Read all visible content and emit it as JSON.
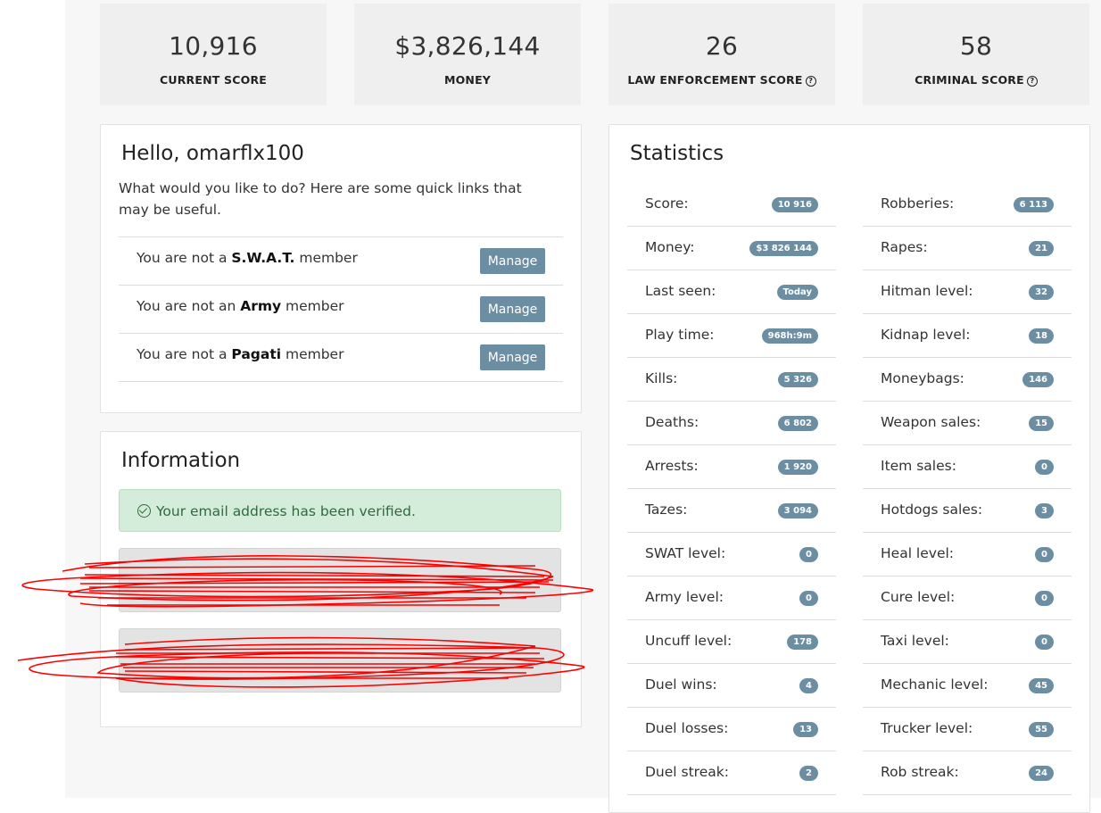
{
  "top_stats": [
    {
      "value": "10,916",
      "label": "CURRENT SCORE",
      "help": false
    },
    {
      "value": "$3,826,144",
      "label": "MONEY",
      "help": false
    },
    {
      "value": "26",
      "label": "LAW ENFORCEMENT SCORE",
      "help": true
    },
    {
      "value": "58",
      "label": "CRIMINAL SCORE",
      "help": true
    }
  ],
  "welcome": {
    "title": "Hello, omarflx100",
    "intro": "What would you like to do? Here are some quick links that may be useful.",
    "links": [
      {
        "prefix": "You are not a ",
        "group": "S.W.A.T.",
        "suffix": " member",
        "button": "Manage"
      },
      {
        "prefix": "You are not an ",
        "group": "Army",
        "suffix": " member",
        "button": "Manage"
      },
      {
        "prefix": "You are not a ",
        "group": "Pagati",
        "suffix": " member",
        "button": "Manage"
      }
    ]
  },
  "information": {
    "title": "Information",
    "verified": "Your email address has been verified."
  },
  "statistics": {
    "title": "Statistics",
    "left": [
      {
        "label": "Score:",
        "value": "10 916"
      },
      {
        "label": "Money:",
        "value": "$3 826 144"
      },
      {
        "label": "Last seen:",
        "value": "Today"
      },
      {
        "label": "Play time:",
        "value": "968h:9m"
      },
      {
        "label": "Kills:",
        "value": "5 326"
      },
      {
        "label": "Deaths:",
        "value": "6 802"
      },
      {
        "label": "Arrests:",
        "value": "1 920"
      },
      {
        "label": "Tazes:",
        "value": "3 094"
      },
      {
        "label": "SWAT level:",
        "value": "0"
      },
      {
        "label": "Army level:",
        "value": "0"
      },
      {
        "label": "Uncuff level:",
        "value": "178"
      },
      {
        "label": "Duel wins:",
        "value": "4"
      },
      {
        "label": "Duel losses:",
        "value": "13"
      },
      {
        "label": "Duel streak:",
        "value": "2"
      }
    ],
    "right": [
      {
        "label": "Robberies:",
        "value": "6 113"
      },
      {
        "label": "Rapes:",
        "value": "21"
      },
      {
        "label": "Hitman level:",
        "value": "32"
      },
      {
        "label": "Kidnap level:",
        "value": "18"
      },
      {
        "label": "Moneybags:",
        "value": "146"
      },
      {
        "label": "Weapon sales:",
        "value": "15"
      },
      {
        "label": "Item sales:",
        "value": "0"
      },
      {
        "label": "Hotdogs sales:",
        "value": "3"
      },
      {
        "label": "Heal level:",
        "value": "0"
      },
      {
        "label": "Cure level:",
        "value": "0"
      },
      {
        "label": "Taxi level:",
        "value": "0"
      },
      {
        "label": "Mechanic level:",
        "value": "45"
      },
      {
        "label": "Trucker level:",
        "value": "55"
      },
      {
        "label": "Rob streak:",
        "value": "24"
      }
    ]
  },
  "colors": {
    "badge": "#6b8ea3",
    "success_bg": "#d4edda",
    "redaction": "#ff0000"
  }
}
